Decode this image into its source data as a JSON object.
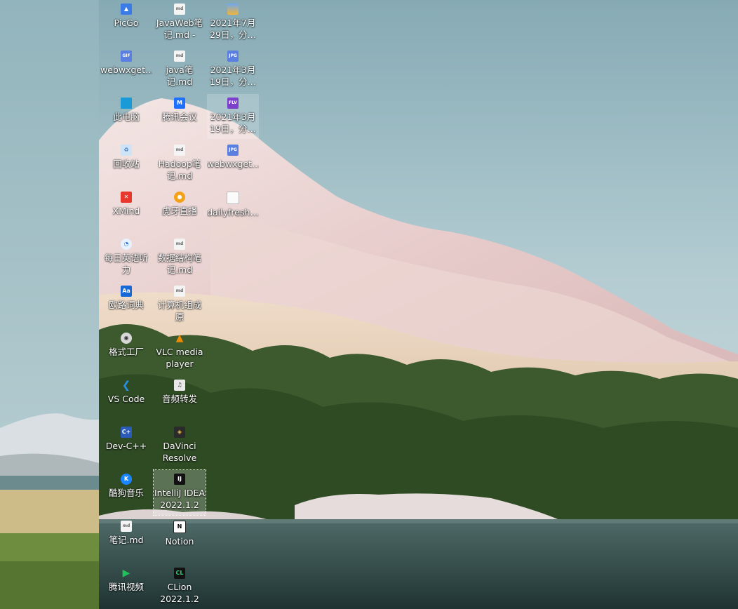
{
  "desktop": {
    "icons": [
      {
        "label": "PicGo",
        "icon": "picgo-icon",
        "glyph": "▲"
      },
      {
        "label": "JavaWeb笔\n记.md - 快…",
        "icon": "markdown-file-icon",
        "glyph": "md"
      },
      {
        "label": "2021年7月\n29日，分…",
        "icon": "image-folder-icon",
        "glyph": ""
      },
      {
        "label": "webwxget…",
        "icon": "gif-file-icon",
        "glyph": "GIF"
      },
      {
        "label": "java笔记.md",
        "icon": "markdown-file-icon",
        "glyph": "md"
      },
      {
        "label": "2021年3月\n19日，分…",
        "icon": "jpg-file-icon",
        "glyph": "JPG"
      },
      {
        "label": "此电脑",
        "icon": "this-pc-icon",
        "glyph": ""
      },
      {
        "label": "腾讯会议",
        "icon": "tencent-meeting-icon",
        "glyph": "M"
      },
      {
        "label": "2021年3月\n19日，分…",
        "icon": "flv-file-icon",
        "glyph": "FLV"
      },
      {
        "label": "回收站",
        "icon": "recycle-bin-icon",
        "glyph": "♻"
      },
      {
        "label": "Hadoop笔\n记.md",
        "icon": "markdown-file-icon",
        "glyph": "md"
      },
      {
        "label": "webwxget…",
        "icon": "jpg-file-icon",
        "glyph": "JPG"
      },
      {
        "label": "XMind",
        "icon": "xmind-icon",
        "glyph": "✕"
      },
      {
        "label": "虎牙直播",
        "icon": "huya-live-icon",
        "glyph": "●"
      },
      {
        "label": "dailyfresh…",
        "icon": "blank-file-icon",
        "glyph": ""
      },
      {
        "label": "每日英语听力",
        "icon": "daily-english-icon",
        "glyph": "◔"
      },
      {
        "label": "数据结构笔\n记.md",
        "icon": "markdown-file-icon",
        "glyph": "md"
      },
      {
        "label": "欧路词典",
        "icon": "eudic-dictionary-icon",
        "glyph": "Aa"
      },
      {
        "label": "计算机组成原\n理笔记.md",
        "icon": "markdown-file-icon",
        "glyph": "md"
      },
      {
        "label": "格式工厂",
        "icon": "format-factory-icon",
        "glyph": "◉"
      },
      {
        "label": "VLC media\nplayer",
        "icon": "vlc-cone-icon",
        "glyph": "▲"
      },
      {
        "label": "VS Code",
        "icon": "vscode-icon",
        "glyph": "❮"
      },
      {
        "label": "音频转发",
        "icon": "audio-forward-icon",
        "glyph": "♫"
      },
      {
        "label": "Dev-C++",
        "icon": "devcpp-icon",
        "glyph": "C+"
      },
      {
        "label": "DaVinci\nResolve",
        "icon": "davinci-resolve-icon",
        "glyph": "◈"
      },
      {
        "label": "酷狗音乐",
        "icon": "kugou-music-icon",
        "glyph": "K"
      },
      {
        "label": "IntelliJ IDEA\n2022.1.2",
        "icon": "intellij-idea-icon",
        "glyph": "IJ"
      },
      {
        "label": "笔记.md",
        "icon": "markdown-file-icon",
        "glyph": "md"
      },
      {
        "label": "Notion",
        "icon": "notion-icon",
        "glyph": "N"
      },
      {
        "label": "腾讯视频",
        "icon": "tencent-video-icon",
        "glyph": "▶"
      },
      {
        "label": "CLion\n2022.1.2",
        "icon": "clion-icon",
        "glyph": "CL"
      }
    ],
    "selected_icon": "IntelliJ IDEA 2022.1.2",
    "hovered_icon": "2021年3月 19日，分…"
  }
}
